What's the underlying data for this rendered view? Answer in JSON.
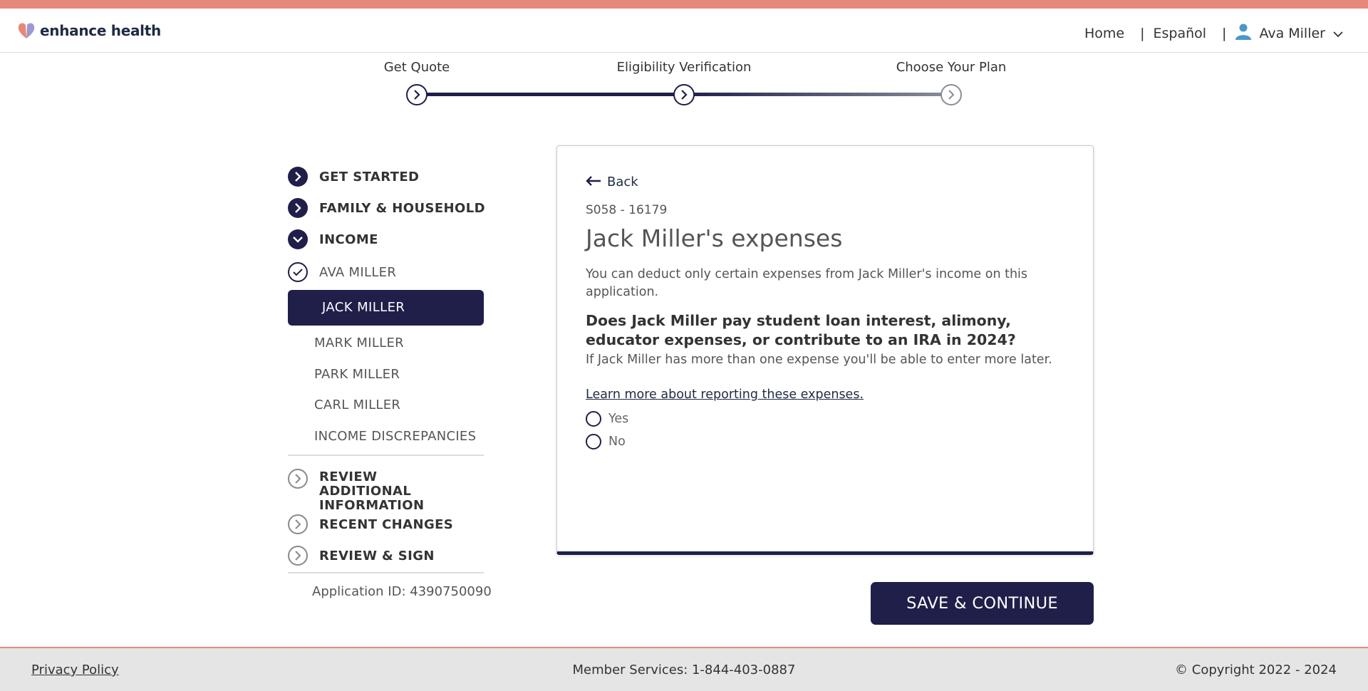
{
  "header": {
    "brand": "enhance health",
    "nav": {
      "home": "Home",
      "language": "Español",
      "user_name": "Ava Miller"
    }
  },
  "progress": {
    "steps": [
      {
        "label": "Get Quote",
        "state": "complete"
      },
      {
        "label": "Eligibility Verification",
        "state": "current"
      },
      {
        "label": "Choose Your Plan",
        "state": "upcoming"
      }
    ]
  },
  "sidebar": {
    "sections": {
      "get_started": "GET STARTED",
      "family_household": "FAMILY & HOUSEHOLD",
      "income": "INCOME",
      "review_additional": "REVIEW ADDITIONAL INFORMATION",
      "recent_changes": "RECENT CHANGES",
      "review_sign": "REVIEW & SIGN"
    },
    "income_items": {
      "ava": "AVA MILLER",
      "jack": "JACK MILLER",
      "mark": "MARK MILLER",
      "park": "PARK MILLER",
      "carl": "CARL MILLER",
      "discrepancies": "INCOME DISCREPANCIES"
    },
    "application_id": "Application ID: 4390750090"
  },
  "card": {
    "back_label": "Back",
    "reference": "S058 - 16179",
    "title": "Jack Miller's expenses",
    "description": "You can deduct only certain expenses from Jack Miller's income on this application.",
    "question": "Does Jack Miller pay student loan interest, alimony, educator expenses, or contribute to an IRA in 2024?",
    "hint": "If Jack Miller has more than one expense you'll be able to enter more later.",
    "learn_more": "Learn more about reporting these expenses.",
    "options": {
      "yes": "Yes",
      "no": "No"
    },
    "selected": null
  },
  "actions": {
    "save_continue": "SAVE & CONTINUE"
  },
  "footer": {
    "privacy": "Privacy Policy",
    "member_services": "Member Services: 1-844-403-0887",
    "copyright": "© Copyright 2022 - 2024"
  },
  "colors": {
    "accent": "#e8887a",
    "navy": "#1f1f4a"
  }
}
